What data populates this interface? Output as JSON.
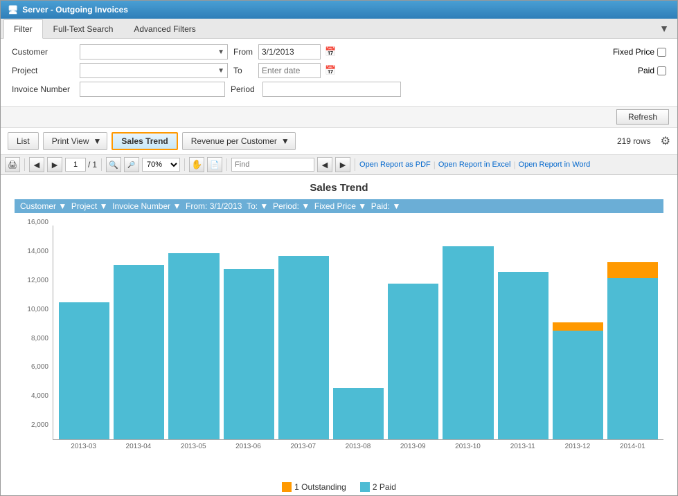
{
  "window": {
    "title": "Server - Outgoing Invoices"
  },
  "tabs": {
    "items": [
      "Filter",
      "Full-Text Search",
      "Advanced Filters"
    ],
    "active": 0
  },
  "filter": {
    "customer_label": "Customer",
    "project_label": "Project",
    "invoice_number_label": "Invoice Number",
    "from_label": "From",
    "to_label": "To",
    "period_label": "Period",
    "fixed_price_label": "Fixed Price",
    "paid_label": "Paid",
    "from_value": "3/1/2013",
    "to_placeholder": "Enter date"
  },
  "toolbar": {
    "refresh_label": "Refresh",
    "list_label": "List",
    "print_view_label": "Print View",
    "sales_trend_label": "Sales Trend",
    "revenue_per_customer_label": "Revenue per Customer",
    "rows_count": "219 rows"
  },
  "report_toolbar": {
    "page_current": "1",
    "page_total": "1",
    "zoom_value": "70%",
    "find_placeholder": "Find",
    "open_as_pdf": "Open Report as PDF",
    "open_in_excel": "Open Report in Excel",
    "open_in_word": "Open Report in Word"
  },
  "chart": {
    "title": "Sales Trend",
    "filter_chips": "Customer ▼  Project ▼  Invoice Number ▼  From: 3/1/2013  To: ▼  Period: ▼  Fixed Price ▼  Paid: ▼",
    "bars": [
      {
        "month": "2013-03",
        "paid": 10200,
        "outstanding": 0
      },
      {
        "month": "2013-04",
        "paid": 13000,
        "outstanding": 0
      },
      {
        "month": "2013-05",
        "paid": 13900,
        "outstanding": 0
      },
      {
        "month": "2013-06",
        "paid": 12700,
        "outstanding": 0
      },
      {
        "month": "2013-07",
        "paid": 13700,
        "outstanding": 0
      },
      {
        "month": "2013-08",
        "paid": 3800,
        "outstanding": 0
      },
      {
        "month": "2013-09",
        "paid": 11600,
        "outstanding": 0
      },
      {
        "month": "2013-10",
        "paid": 14400,
        "outstanding": 0
      },
      {
        "month": "2013-11",
        "paid": 12500,
        "outstanding": 0
      },
      {
        "month": "2013-12",
        "paid": 8100,
        "outstanding": 600
      },
      {
        "month": "2014-01",
        "paid": 12000,
        "outstanding": 1200
      }
    ],
    "y_labels": [
      "16,000",
      "14,000",
      "12,000",
      "10,000",
      "8,000",
      "6,000",
      "4,000",
      "2,000",
      ""
    ],
    "max_value": 16000,
    "legend": [
      {
        "color": "#f90",
        "label": "1 Outstanding"
      },
      {
        "color": "#4dbcd4",
        "label": "2 Paid"
      }
    ]
  }
}
